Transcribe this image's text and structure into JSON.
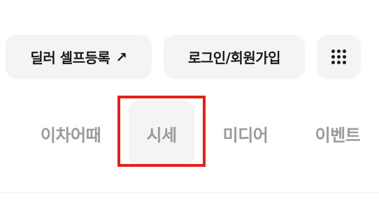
{
  "header": {
    "dealer_button": {
      "label": "딜러 셀프등록",
      "arrow": "↗",
      "icon": "external-arrow-icon"
    },
    "login_button": {
      "label": "로그인/회원가입"
    },
    "menu_button": {
      "icon": "grid-menu-icon"
    }
  },
  "tabs": {
    "items": [
      {
        "label": "이차어때"
      },
      {
        "label": "시세",
        "selected": true
      },
      {
        "label": "미디어"
      },
      {
        "label": "이벤트"
      }
    ]
  },
  "colors": {
    "pill_background": "#f4f4f4",
    "tab_text": "#9a9a9a",
    "highlight_border": "#e0221c",
    "text_dark": "#1a1a1a"
  }
}
